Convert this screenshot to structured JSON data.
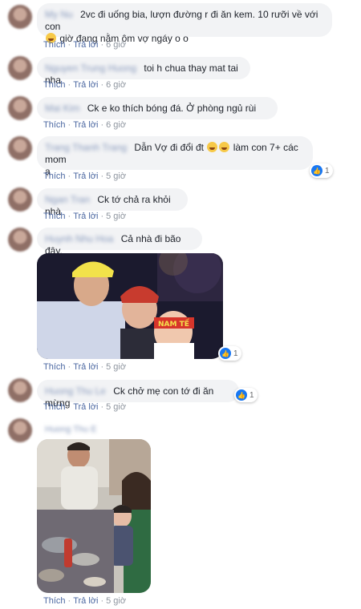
{
  "actions": {
    "like": "Thích",
    "reply": "Trả lời",
    "dot": "·"
  },
  "comments": [
    {
      "name": "My Nu",
      "text_line1": "2vc đi uống bia, lượn đường r đi ăn kem. 10 rưỡi về với con",
      "text_line2": "giờ đang nằm ôm vợ ngáy o o",
      "time": "6 giờ"
    },
    {
      "name": "Nguyen Trung Huong",
      "text": "toi h chua thay mat tai nha",
      "time": "6 giờ"
    },
    {
      "name": "Mai Kim",
      "text": "Ck e ko thích bóng đá. Ở phòng ngủ rùi",
      "time": "6 giờ"
    },
    {
      "name": "Trang Thanh Trang",
      "text_before": "Dẫn Vợ đi đổi đt",
      "text_after": "làm con 7+ các mom",
      "text_line2": "ạ",
      "time": "5 giờ",
      "reactions": "1"
    },
    {
      "name": "Ngan Tran",
      "text": "Ck tớ chả ra khỏi nhà",
      "time": "5 giờ"
    },
    {
      "name": "Huynh Nhu Hoa",
      "text": "Cả nhà đi bão đây.",
      "time": "5 giờ",
      "reactions": "1",
      "photo_banner": "NAM TẾ"
    },
    {
      "name": "Huong Thu Le",
      "text": "Ck chở mẹ con tớ đi ăn mừng",
      "time": "5 giờ",
      "reactions": "1"
    },
    {
      "name": "Huong Thu E",
      "time": "5 giờ"
    }
  ],
  "colors": {
    "link": "#4b67a1",
    "bubble": "#f2f3f5",
    "like": "#1877f2"
  }
}
